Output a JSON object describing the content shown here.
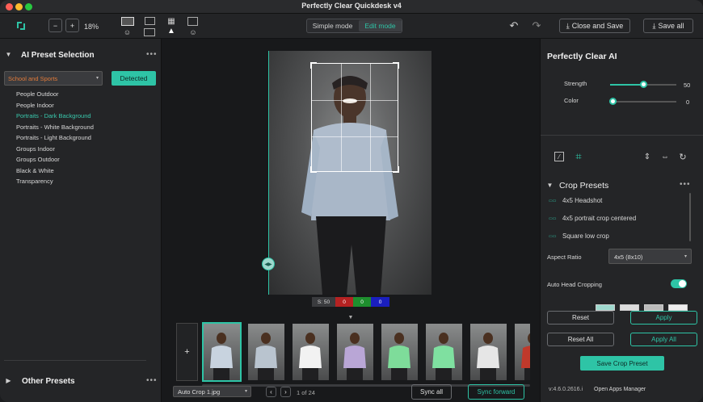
{
  "window": {
    "title": "Perfectly Clear Quickdesk v4"
  },
  "toolbar": {
    "zoom": "18%",
    "mode_simple": "Simple mode",
    "mode_edit": "Edit mode",
    "close_save": "Close and Save",
    "save_all": "Save all"
  },
  "left": {
    "preset_title": "AI Preset Selection",
    "dropdown_value": "School and Sports",
    "detected_label": "Detected",
    "presets": [
      "People Outdoor",
      "People Indoor",
      "Portraits - Dark Background",
      "Portraits - White Background",
      "Portraits - Light Background",
      "Groups Indoor",
      "Groups Outdoor",
      "Black & White",
      "Transparency"
    ],
    "active_preset_index": 2,
    "other_presets": "Other Presets"
  },
  "center": {
    "stats": {
      "s": "S: 50",
      "r": "0",
      "g": "0",
      "b": "0"
    },
    "filename": "Auto Crop 1.jpg",
    "page_info": "1 of 24",
    "sync_all": "Sync all",
    "sync_forward": "Sync forward",
    "add_label": "+"
  },
  "right": {
    "title": "Perfectly Clear AI",
    "strength_label": "Strength",
    "strength_value": "50",
    "strength_fraction": 0.5,
    "color_label": "Color",
    "color_value": "0",
    "color_fraction": 0.0,
    "crop_presets_title": "Crop Presets",
    "crop_presets": [
      "4x5 Headshot",
      "4x5 portrait crop centered",
      "Square low crop"
    ],
    "aspect_label": "Aspect Ratio",
    "aspect_value": "4x5 (8x10)",
    "auto_head_label": "Auto Head Cropping",
    "auto_head_on": true,
    "reset": "Reset",
    "apply": "Apply",
    "reset_all": "Reset All",
    "apply_all": "Apply All",
    "save_crop_preset": "Save Crop Preset",
    "version": "v:4.6.0.2616.i",
    "open_apps": "Open Apps Manager"
  },
  "colors": {
    "accent": "#2ec4a6",
    "dropdown_text": "#e07a3a"
  }
}
